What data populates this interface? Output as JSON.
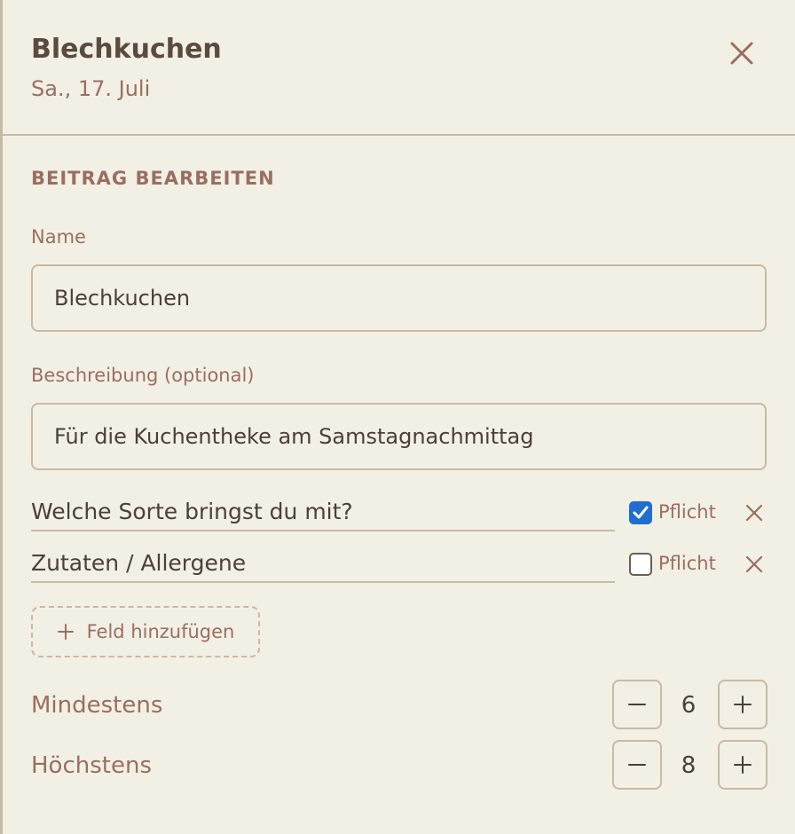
{
  "header": {
    "title": "Blechkuchen",
    "subtitle": "Sa., 17. Juli",
    "close_icon": "close-icon"
  },
  "form": {
    "section_title": "BEITRAG BEARBEITEN",
    "name_label": "Name",
    "name_value": "Blechkuchen",
    "description_label": "Beschreibung (optional)",
    "description_value": "Für die Kuchentheke am Samstagnachmittag"
  },
  "fields": [
    {
      "label": "Welche Sorte bringst du mit?",
      "required": true,
      "required_label": "Pflicht"
    },
    {
      "label": "Zutaten / Allergene",
      "required": false,
      "required_label": "Pflicht"
    }
  ],
  "add_field_label": "Feld hinzufügen",
  "steppers": {
    "min_label": "Mindestens",
    "min_value": "6",
    "max_label": "Höchstens",
    "max_value": "8"
  },
  "colors": {
    "background": "#f2f0e4",
    "border": "#c9b9a4",
    "accent_text": "#9b6e62",
    "checkbox_checked": "#1f6fd1"
  }
}
